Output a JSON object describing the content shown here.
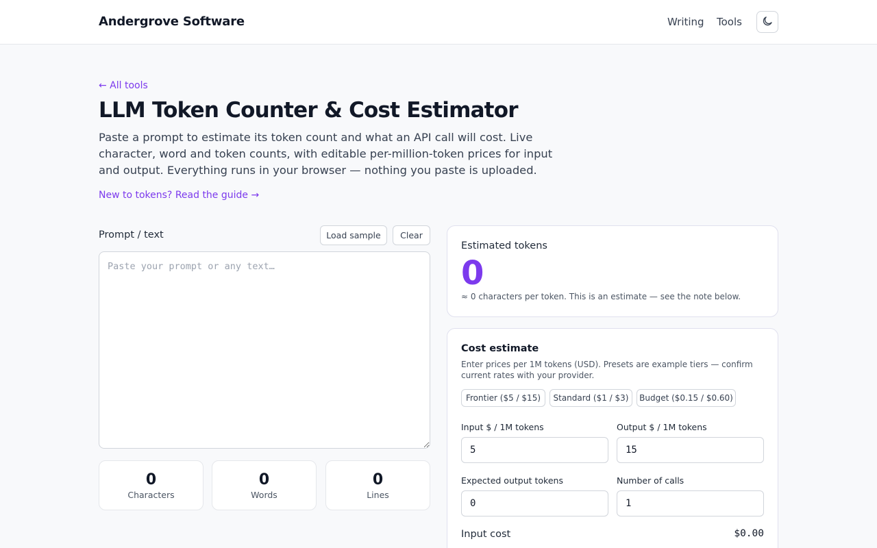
{
  "header": {
    "brand": "Andergrove Software",
    "nav": [
      "Writing",
      "Tools"
    ],
    "theme_icon": "moon-icon"
  },
  "page": {
    "back_link": "← All tools",
    "title": "LLM Token Counter & Cost Estimator",
    "intro": "Paste a prompt to estimate its token count and what an API call will cost. Live character, word and token counts, with editable per-million-token prices for input and output. Everything runs in your browser — nothing you paste is uploaded.",
    "guide_link": "New to tokens? Read the guide →"
  },
  "prompt": {
    "label": "Prompt / text",
    "load_sample": "Load sample",
    "clear": "Clear",
    "placeholder": "Paste your prompt or any text…",
    "value": ""
  },
  "stats": [
    {
      "value": "0",
      "label": "Characters"
    },
    {
      "value": "0",
      "label": "Words"
    },
    {
      "value": "0",
      "label": "Lines"
    }
  ],
  "tokens": {
    "label": "Estimated tokens",
    "value": "0",
    "note": "≈ 0 characters per token. This is an estimate — see the note below."
  },
  "cost": {
    "title": "Cost estimate",
    "description": "Enter prices per 1M tokens (USD). Presets are example tiers — confirm current rates with your provider.",
    "presets": [
      "Frontier ($5 / $15)",
      "Standard ($1 / $3)",
      "Budget ($0.15 / $0.60)"
    ],
    "input_price_label": "Input $ / 1M tokens",
    "input_price": "5",
    "output_price_label": "Output $ / 1M tokens",
    "output_price": "15",
    "expected_output_label": "Expected output tokens",
    "expected_output": "0",
    "calls_label": "Number of calls",
    "calls": "1",
    "input_cost_label": "Input cost",
    "input_cost": "$0.00"
  },
  "colors": {
    "accent": "#7c3aed",
    "background": "#f8f9fb"
  }
}
